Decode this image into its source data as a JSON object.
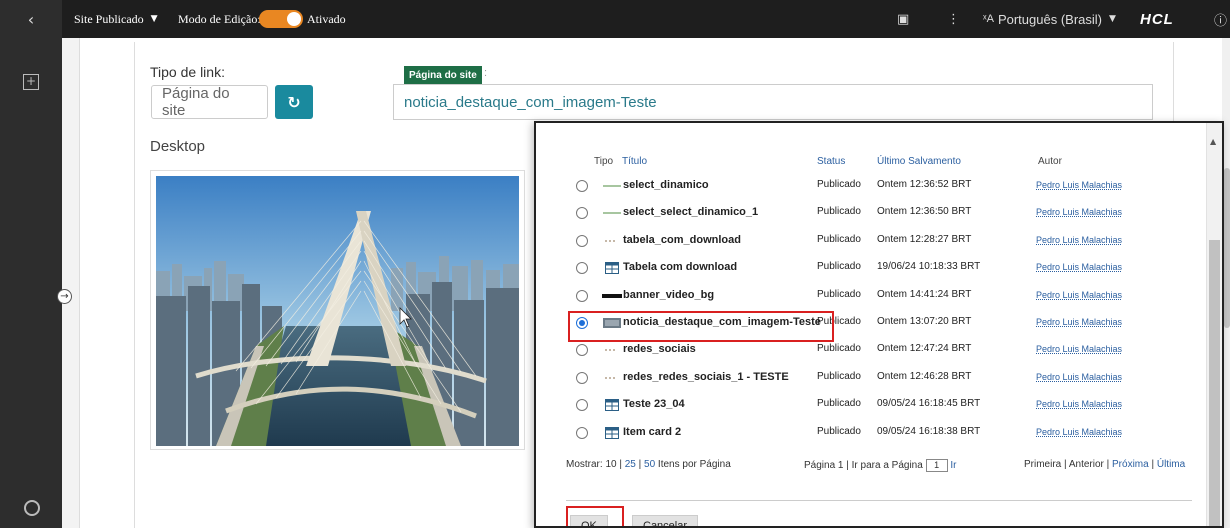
{
  "topbar": {
    "back_icon": "chevron-left-icon",
    "site_status": "Site Publicado",
    "edit_mode_label": "Modo de Edição:",
    "edit_mode_value": "Ativado",
    "language": "Português (Brasil)",
    "brand": "HCL",
    "accent_color": "#e98722"
  },
  "editor": {
    "link_type_label": "Tipo de link:",
    "link_type_value": "Página do site",
    "badge": "Página do site",
    "badge_suffix": ":",
    "link_value": "noticia_destaque_com_imagem-Teste",
    "device_label": "Desktop"
  },
  "modal": {
    "columns": {
      "type": "Tipo",
      "title": "Título",
      "status": "Status",
      "saved": "Último Salvamento",
      "author": "Autor"
    },
    "rows": [
      {
        "title": "select_dinamico",
        "status": "Publicado",
        "saved": "Ontem 12:36:52 BRT",
        "author": "Pedro Luis Malachias",
        "icon": "line-icon",
        "selected": false
      },
      {
        "title": "select_select_dinamico_1",
        "status": "Publicado",
        "saved": "Ontem 12:36:50 BRT",
        "author": "Pedro Luis Malachias",
        "icon": "line-icon",
        "selected": false
      },
      {
        "title": "tabela_com_download",
        "status": "Publicado",
        "saved": "Ontem 12:28:27 BRT",
        "author": "Pedro Luis Malachias",
        "icon": "dots-icon",
        "selected": false
      },
      {
        "title": "Tabela com download",
        "status": "Publicado",
        "saved": "19/06/24 10:18:33 BRT",
        "author": "Pedro Luis Malachias",
        "icon": "table-icon",
        "selected": false
      },
      {
        "title": "banner_video_bg",
        "status": "Publicado",
        "saved": "Ontem 14:41:24 BRT",
        "author": "Pedro Luis Malachias",
        "icon": "bar-icon",
        "selected": false
      },
      {
        "title": "noticia_destaque_com_imagem-Teste",
        "status": "Publicado",
        "saved": "Ontem 13:07:20 BRT",
        "author": "Pedro Luis Malachias",
        "icon": "image-icon",
        "selected": true
      },
      {
        "title": "redes_sociais",
        "status": "Publicado",
        "saved": "Ontem 12:47:24 BRT",
        "author": "Pedro Luis Malachias",
        "icon": "dots-icon",
        "selected": false
      },
      {
        "title": "redes_redes_sociais_1 - TESTE",
        "status": "Publicado",
        "saved": "Ontem 12:46:28 BRT",
        "author": "Pedro Luis Malachias",
        "icon": "dots-icon",
        "selected": false
      },
      {
        "title": "Teste 23_04",
        "status": "Publicado",
        "saved": "09/05/24 16:18:45 BRT",
        "author": "Pedro Luis Malachias",
        "icon": "table-icon",
        "selected": false
      },
      {
        "title": "Item card 2",
        "status": "Publicado",
        "saved": "09/05/24 16:18:38 BRT",
        "author": "Pedro Luis Malachias",
        "icon": "table-icon",
        "selected": false
      }
    ],
    "pager": {
      "show_label": "Mostrar:",
      "size_10": "10",
      "size_25": "25",
      "size_50": "50",
      "per_page": "Itens por Página",
      "page_info": "Página 1",
      "goto_label": "Ir para a Página",
      "goto_value": "1",
      "go": "Ir",
      "first": "Primeira",
      "prev": "Anterior",
      "next": "Próxima",
      "last": "Última"
    },
    "ok": "OK",
    "cancel": "Cancelar",
    "highlight_color": "#d92020"
  },
  "accessibility": {
    "a11y_icon": "accessibility-icon",
    "sign_icon": "sign-language-icon"
  }
}
